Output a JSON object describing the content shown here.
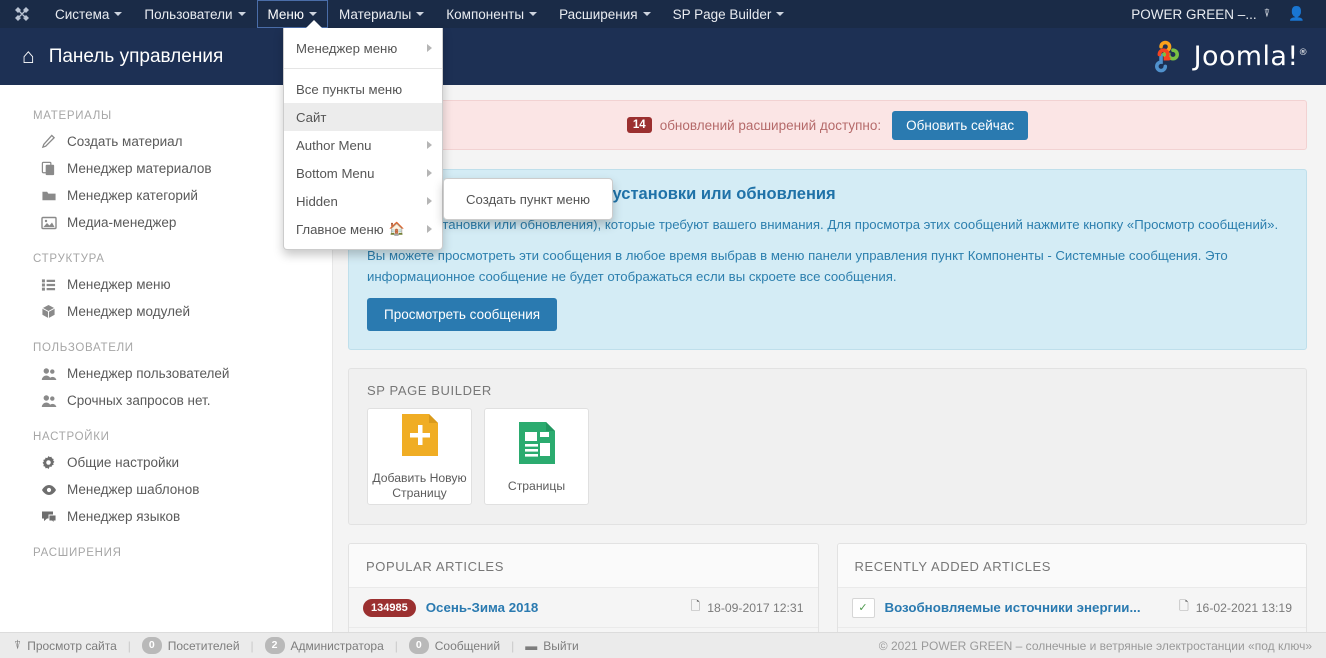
{
  "navbar": {
    "logo_icon": "joomla-logo-icon",
    "items": [
      {
        "label": "Система",
        "caret": true,
        "active": false
      },
      {
        "label": "Пользователи",
        "caret": true,
        "active": false
      },
      {
        "label": "Меню",
        "caret": true,
        "active": true
      },
      {
        "label": "Материалы",
        "caret": true,
        "active": false
      },
      {
        "label": "Компоненты",
        "caret": true,
        "active": false
      },
      {
        "label": "Расширения",
        "caret": true,
        "active": false
      },
      {
        "label": "SP Page Builder",
        "caret": true,
        "active": false
      }
    ],
    "site_name": "POWER GREEN –...",
    "site_icon": "external-link-icon",
    "user_icon": "user-icon"
  },
  "header": {
    "home_icon": "home-icon",
    "title": "Панель управления",
    "brand": "Joomla!",
    "brand_sup": "®"
  },
  "dropdown": {
    "items": [
      {
        "label": "Менеджер меню",
        "submenu": true,
        "highlight": false,
        "divider_after": true
      },
      {
        "label": "Все пункты меню",
        "submenu": false,
        "highlight": false
      },
      {
        "label": "Сайт",
        "submenu": false,
        "highlight": true
      },
      {
        "label": "Author Menu",
        "submenu": true,
        "highlight": false
      },
      {
        "label": "Bottom Menu",
        "submenu": true,
        "highlight": false
      },
      {
        "label": "Hidden",
        "submenu": true,
        "highlight": false
      },
      {
        "label": "Главное меню",
        "submenu": true,
        "highlight": false,
        "home_badge": "⌂"
      }
    ],
    "submenu_item": "Создать пункт меню"
  },
  "sidebar": {
    "groups": [
      {
        "title": "МАТЕРИАЛЫ",
        "items": [
          {
            "label": "Создать материал",
            "icon": "pencil-icon"
          },
          {
            "label": "Менеджер материалов",
            "icon": "copy-icon"
          },
          {
            "label": "Менеджер категорий",
            "icon": "folder-icon"
          },
          {
            "label": "Медиа-менеджер",
            "icon": "image-icon"
          }
        ]
      },
      {
        "title": "СТРУКТУРА",
        "items": [
          {
            "label": "Менеджер меню",
            "icon": "list-icon"
          },
          {
            "label": "Менеджер модулей",
            "icon": "cube-icon"
          }
        ]
      },
      {
        "title": "ПОЛЬЗОВАТЕЛИ",
        "items": [
          {
            "label": "Менеджер пользователей",
            "icon": "users-icon"
          },
          {
            "label": "Срочных запросов нет.",
            "icon": "users-icon"
          }
        ]
      },
      {
        "title": "НАСТРОЙКИ",
        "items": [
          {
            "label": "Общие настройки",
            "icon": "gear-icon"
          },
          {
            "label": "Менеджер шаблонов",
            "icon": "eye-icon"
          },
          {
            "label": "Менеджер языков",
            "icon": "comment-icon"
          }
        ]
      },
      {
        "title": "РАСШИРЕНИЯ",
        "items": []
      }
    ]
  },
  "update_alert": {
    "count": "14",
    "text": "обновлений расширений доступно:",
    "button": "Обновить сейчас"
  },
  "info_alert": {
    "heading": "системные сообщения после установки или обновления",
    "paragraph1": "ия (после установки или обновления), которые требуют вашего внимания. Для просмотра этих сообщений нажмите кнопку «Просмотр сообщений».",
    "paragraph2": "Вы можете просмотреть эти сообщения в любое время выбрав в меню панели управления пункт Компоненты - Системные сообщения. Это информационное сообщение не будет отображаться если вы скроете все сообщения.",
    "button": "Просмотреть сообщения"
  },
  "page_builder": {
    "title": "SP PAGE BUILDER",
    "tiles": [
      {
        "label": "Добавить Новую Страницу",
        "icon": "new-page-icon",
        "color": "#f0ad24"
      },
      {
        "label": "Страницы",
        "icon": "pages-icon",
        "color": "#2bab6f"
      }
    ]
  },
  "popular_articles": {
    "title": "POPULAR ARTICLES",
    "rows": [
      {
        "hits": "134985",
        "title": "Осень-Зима 2018",
        "date": "18-09-2017 12:31",
        "date_icon": "calendar-icon"
      }
    ]
  },
  "recent_articles": {
    "title": "RECENTLY ADDED ARTICLES",
    "rows": [
      {
        "status_icon": "check-icon",
        "title": "Возобновляемые источники энергии...",
        "date": "16-02-2021 13:19",
        "date_icon": "calendar-icon"
      }
    ]
  },
  "statusbar": {
    "preview": {
      "label": "Просмотр сайта",
      "icon": "external-link-icon"
    },
    "visitors": {
      "count": "0",
      "label": "Посетителей"
    },
    "admins": {
      "count": "2",
      "label": "Администратора"
    },
    "messages": {
      "count": "0",
      "label": "Сообщений"
    },
    "logout": {
      "label": "Выйти",
      "icon": "minus-icon"
    },
    "copyright": "© 2021 POWER GREEN – солнечные и ветряные электростанции «под ключ»"
  },
  "colors": {
    "navbar": "#1a2b47",
    "subheader": "#1d3054",
    "accent_blue": "#2a7ab0",
    "alert_red_bg": "#fbe5e5",
    "alert_info_bg": "#d4ecf5",
    "badge_red": "#9b3030"
  }
}
